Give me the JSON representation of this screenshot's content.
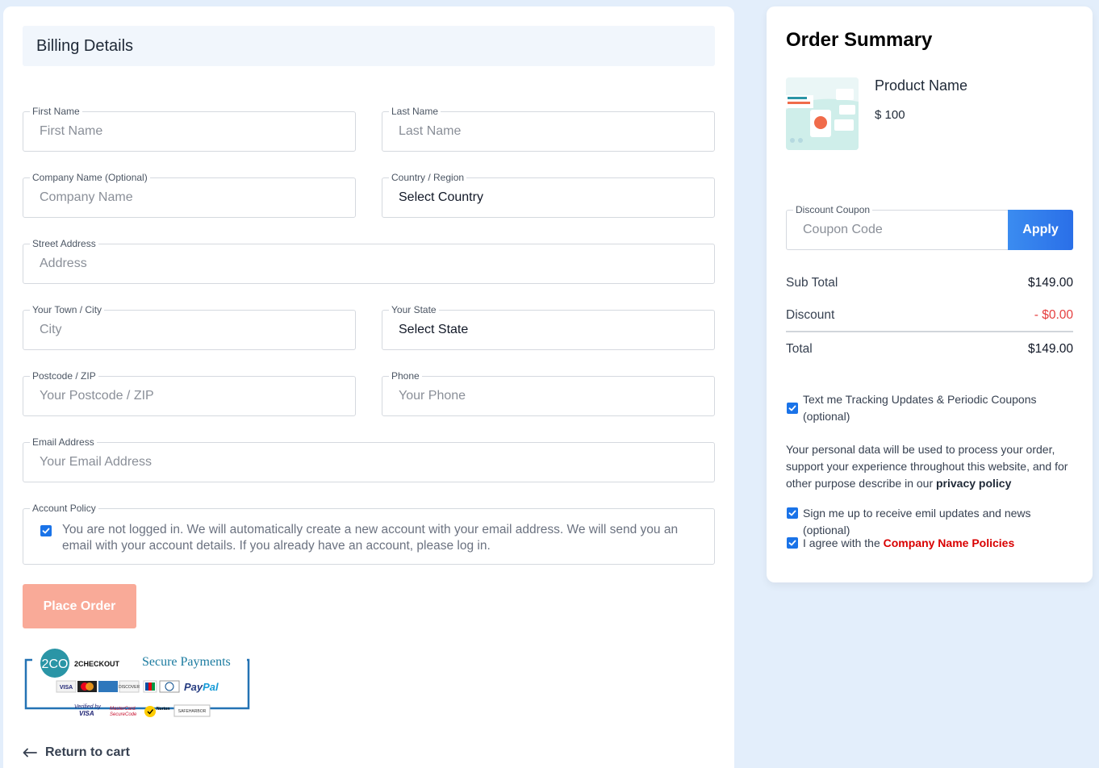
{
  "billing": {
    "title": "Billing Details",
    "fields": {
      "first_name": {
        "label": "First Name",
        "placeholder": "First Name"
      },
      "last_name": {
        "label": "Last Name",
        "placeholder": "Last Name"
      },
      "company": {
        "label": "Company Name (Optional)",
        "placeholder": "Company Name"
      },
      "country": {
        "label": "Country / Region",
        "value": "Select Country"
      },
      "street": {
        "label": "Street Address",
        "placeholder": "Address"
      },
      "city": {
        "label": "Your Town / City",
        "placeholder": "City"
      },
      "state": {
        "label": "Your State",
        "value": "Select State"
      },
      "postcode": {
        "label": "Postcode / ZIP",
        "placeholder": "Your Postcode / ZIP"
      },
      "phone": {
        "label": "Phone",
        "placeholder": "Your Phone"
      },
      "email": {
        "label": "Email Address",
        "placeholder": "Your Email Address"
      }
    },
    "account_policy": {
      "label": "Account Policy",
      "checked": true,
      "text": "You are not logged in. We will automatically create a new account with your email address. We will send you an email with your account details. If you already have an account, please log in."
    },
    "place_order_label": "Place Order",
    "payment_badge": {
      "brand": "2CO",
      "brand_name": "2CHECKOUT",
      "title": "Secure Payments",
      "cards": [
        "VISA",
        "MasterCard",
        "AMEX",
        "DISCOVER",
        "JCB",
        "Diners Club",
        "PayPal"
      ],
      "seals": [
        "Verified by VISA",
        "MasterCard SecureCode",
        "Norton",
        "SAFEHARBOR"
      ]
    },
    "return_label": "Return to cart"
  },
  "order_summary": {
    "title": "Order Summary",
    "product": {
      "name": "Product Name",
      "price": "$ 100"
    },
    "coupon": {
      "label": "Discount Coupon",
      "placeholder": "Coupon Code",
      "apply_label": "Apply"
    },
    "sub_total": {
      "label": "Sub Total",
      "value": "$149.00"
    },
    "discount": {
      "label": "Discount",
      "value": "- $0.00"
    },
    "total": {
      "label": "Total",
      "value": "$149.00"
    },
    "tracking_opt": {
      "text": "Text me Tracking Updates & Periodic Coupons (optional)",
      "checked": true
    },
    "privacy_note": "Your personal data will be used to process your order, support your experience throughout this website, and for other purpose describe in our ",
    "privacy_link": "privacy policy",
    "newsletter_opt": {
      "text": "Sign me up to receive emil updates and news (optional)",
      "checked": true
    },
    "agree_opt": {
      "prefix": "I agree with the ",
      "link": "Company Name Policies",
      "checked": true
    }
  },
  "colors": {
    "page_bg": "#e3eefb",
    "accent_blue": "#2a6fe8",
    "place_order": "#f9aa98",
    "discount_red": "#e53e3e",
    "policy_red": "#d90000"
  }
}
